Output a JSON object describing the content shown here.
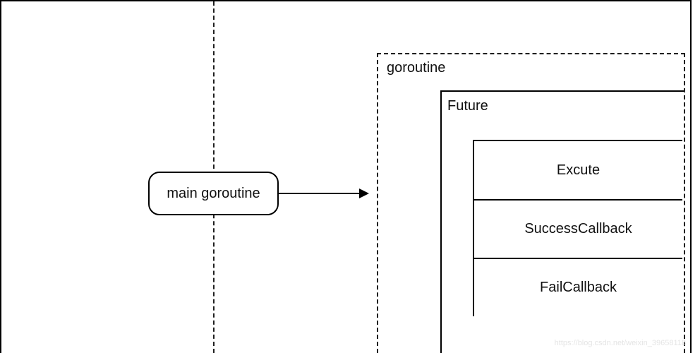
{
  "diagram": {
    "main_goroutine": "main goroutine",
    "goroutine_label": "goroutine",
    "future_label": "Future",
    "cells": {
      "execute": "Excute",
      "success": "SuccessCallback",
      "fail": "FailCallback"
    }
  },
  "watermark": "https://blog.csdn.net/weixin_39658118"
}
